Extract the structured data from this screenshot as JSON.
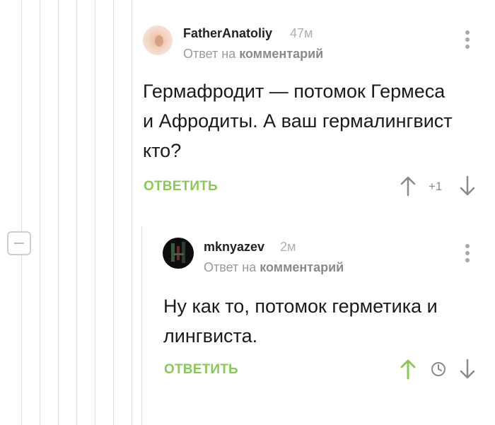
{
  "comments": [
    {
      "username": "FatherAnatoliy",
      "timestamp": "47м",
      "reply_prefix": "Ответ на",
      "reply_target": "комментарий",
      "text_lines": [
        "Гермафродит — потомок Гермеса",
        "и Афродиты. А ваш гермалингвист",
        "кто?"
      ],
      "reply_label": "ОТВЕТИТЬ",
      "score": "+1"
    },
    {
      "username": "mknyazev",
      "timestamp": "2м",
      "reply_prefix": "Ответ на",
      "reply_target": "комментарий",
      "text_lines": [
        "Ну как то, потомок герметика и",
        "лингвиста."
      ],
      "reply_label": "ОТВЕТИТЬ"
    }
  ],
  "colors": {
    "accent_green": "#8ac858",
    "thread_line": "#dcdcdc"
  },
  "icons": [
    "collapse-thread-icon",
    "more-options-icon",
    "upvote-arrow-icon",
    "downvote-arrow-icon",
    "clock-icon"
  ]
}
